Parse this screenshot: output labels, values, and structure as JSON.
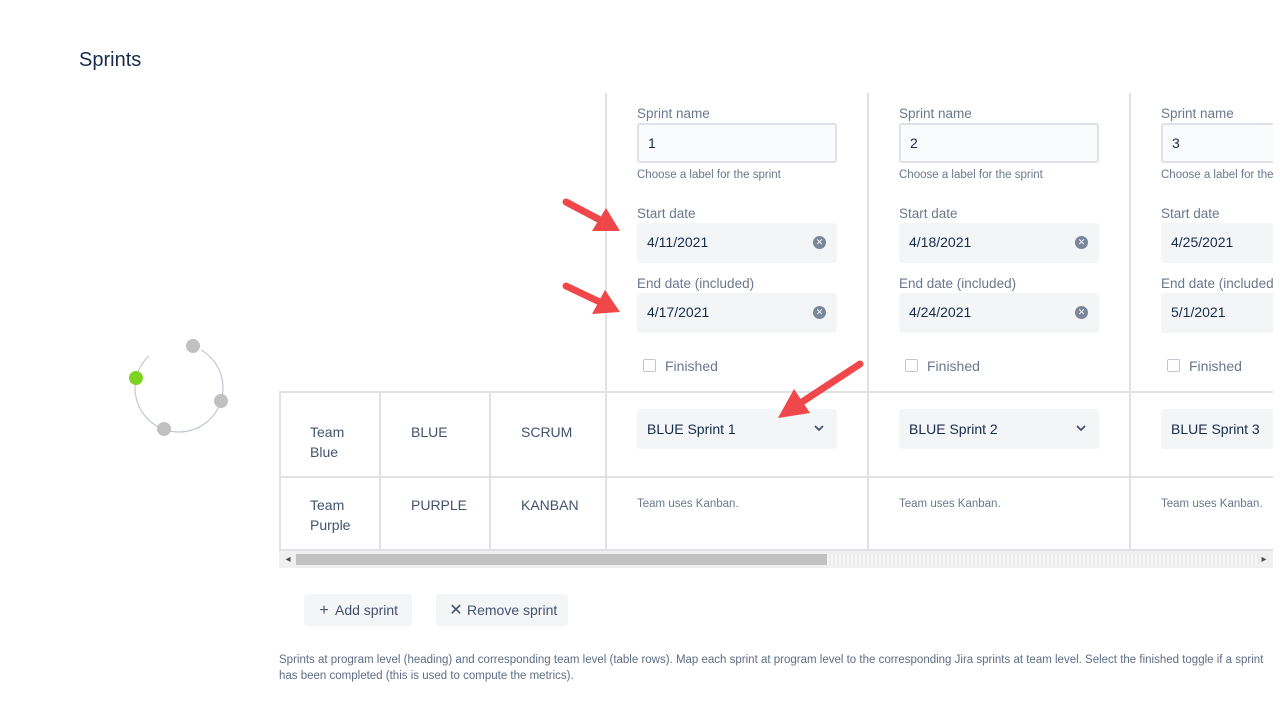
{
  "page": {
    "title": "Sprints"
  },
  "sprints": [
    {
      "name_label": "Sprint name",
      "name": "1",
      "name_help": "Choose a label for the sprint",
      "start_label": "Start date",
      "start": "4/11/2021",
      "end_label": "End date (included)",
      "end": "4/17/2021",
      "finished_label": "Finished",
      "blue_select": "BLUE Sprint 1",
      "purple_note": "Team uses Kanban."
    },
    {
      "name_label": "Sprint name",
      "name": "2",
      "name_help": "Choose a label for the sprint",
      "start_label": "Start date",
      "start": "4/18/2021",
      "end_label": "End date (included)",
      "end": "4/24/2021",
      "finished_label": "Finished",
      "blue_select": "BLUE Sprint 2",
      "purple_note": "Team uses Kanban."
    },
    {
      "name_label": "Sprint name",
      "name": "3",
      "name_help": "Choose a label for the sprint",
      "start_label": "Start date",
      "start": "4/25/2021",
      "end_label": "End date (included)",
      "end": "5/1/2021",
      "finished_label": "Finished",
      "blue_select": "BLUE Sprint 3",
      "purple_note": "Team uses Kanban."
    }
  ],
  "teams": [
    {
      "name": "Team Blue",
      "key": "BLUE",
      "method": "SCRUM"
    },
    {
      "name": "Team Purple",
      "key": "PURPLE",
      "method": "KANBAN"
    }
  ],
  "buttons": {
    "add": "Add sprint",
    "remove": "Remove sprint"
  },
  "footnote": "Sprints at program level (heading) and corresponding team level (table rows). Map each sprint at program level to the corresponding Jira sprints at team level. Select the finished toggle if a sprint has been completed (this is used to compute the metrics).",
  "colors": {
    "annotation_arrow": "#f0474a",
    "ring_active": "#7ed321",
    "ring_idle": "#c1c1c1"
  },
  "icons": {
    "clear": "clear-icon",
    "chevron": "chevron-down-icon",
    "add": "plus-icon",
    "remove": "close-icon"
  }
}
